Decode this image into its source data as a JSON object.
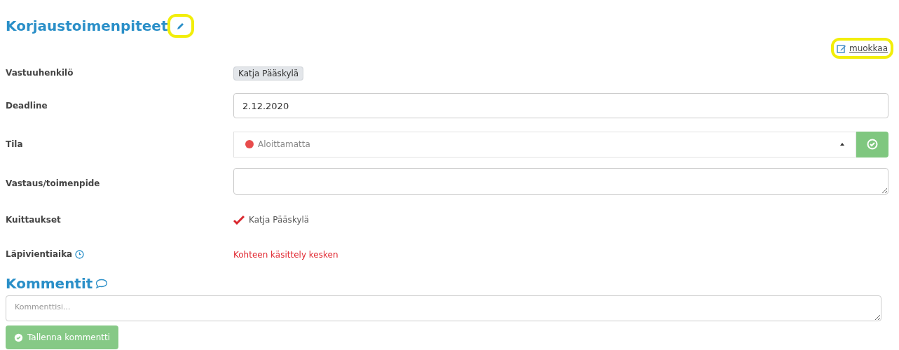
{
  "title": {
    "text": "Korjaustoimenpiteet",
    "highlighted": true
  },
  "edit_link": {
    "text": "muokkaa",
    "highlighted": true
  },
  "fields": [
    {
      "kind": "tag",
      "label": "Vastuuhenkilö",
      "value": "Katja Pääskylä"
    },
    {
      "kind": "input",
      "label": "Deadline",
      "value": "2.12.2020"
    },
    {
      "kind": "select",
      "label": "Tila",
      "value": "Aloittamatta",
      "color": "#e84c4c"
    },
    {
      "kind": "textarea",
      "label": "Vastaus/toimenpide"
    },
    {
      "kind": "ack",
      "label": "Kuittaukset",
      "value": "Katja Pääskylä"
    },
    {
      "kind": "status",
      "label": "Läpivientiaika",
      "value": "Kohteen käsittely kesken"
    }
  ],
  "comments": {
    "title": "Kommentit",
    "placeholder": "Kommenttisi...",
    "save_button": "Tallenna kommentti"
  }
}
